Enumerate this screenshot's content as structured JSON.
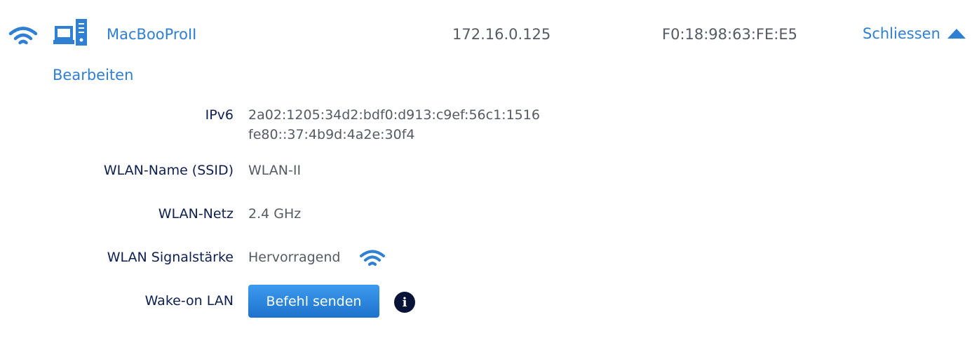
{
  "colors": {
    "accent": "#2f7fd2",
    "label": "#0d1f4f",
    "value": "#555b63",
    "button_bg": "#1f72cc",
    "info_bg": "#071437"
  },
  "device_row": {
    "wifi_icon": "wifi-icon",
    "device_icon": "desktop-computer-icon",
    "name": "MacBooProII",
    "ipv4": "172.16.0.125",
    "mac": "F0:18:98:63:FE:E5",
    "close_label": "Schliessen",
    "close_icon": "triangle-up-icon"
  },
  "edit_label": "Bearbeiten",
  "details": {
    "ipv6": {
      "label": "IPv6",
      "values": [
        "2a02:1205:34d2:bdf0:d913:c9ef:56c1:1516",
        "fe80::37:4b9d:4a2e:30f4"
      ]
    },
    "ssid": {
      "label": "WLAN-Name (SSID)",
      "value": "WLAN-II"
    },
    "network": {
      "label": "WLAN-Netz",
      "value": "2.4 GHz"
    },
    "signal": {
      "label": "WLAN Signalstärke",
      "value": "Hervorragend",
      "icon": "wifi-signal-icon"
    },
    "wol": {
      "label": "Wake-on LAN",
      "button_label": "Befehl senden",
      "info_icon": "info-icon"
    }
  }
}
